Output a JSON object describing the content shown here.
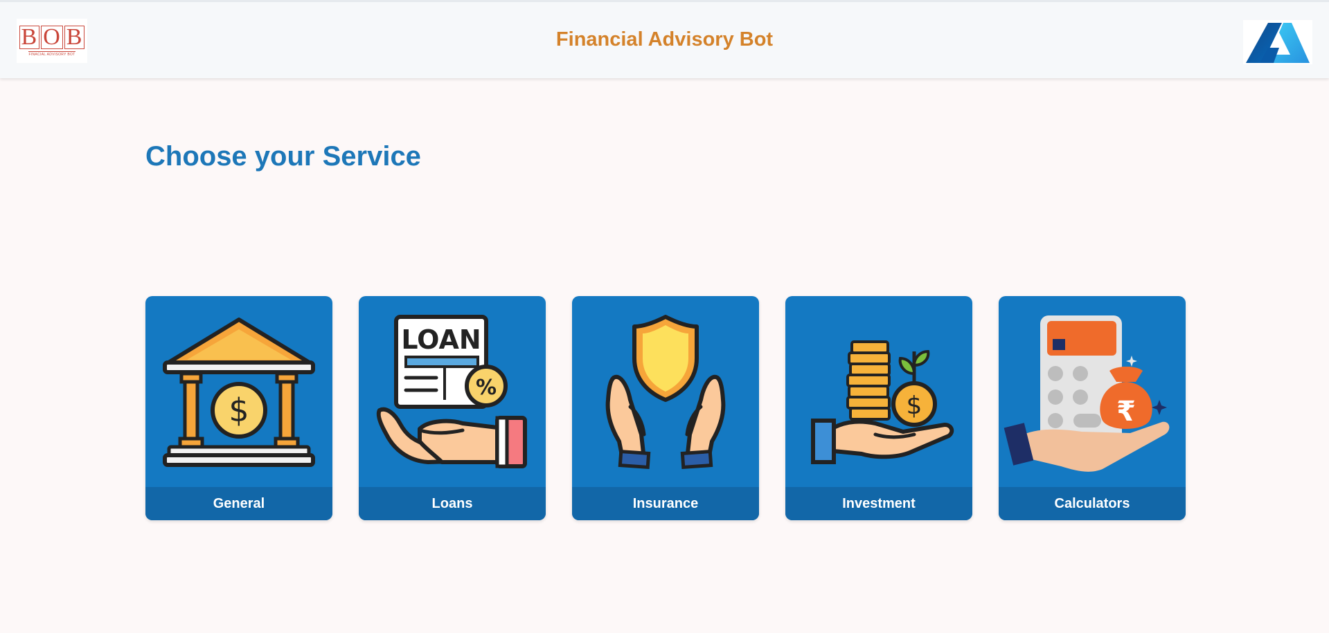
{
  "header": {
    "title": "Financial Advisory Bot",
    "left_logo": {
      "text": "BOB",
      "subtext": "FINACIAL ADVISORY BOT",
      "icon": "bob-logo-icon"
    },
    "right_logo": {
      "icon": "azure-logo-icon"
    }
  },
  "main": {
    "heading": "Choose your Service",
    "services": [
      {
        "label": "General",
        "icon": "bank-icon"
      },
      {
        "label": "Loans",
        "icon": "loan-icon"
      },
      {
        "label": "Insurance",
        "icon": "insurance-shield-icon"
      },
      {
        "label": "Investment",
        "icon": "investment-coins-icon"
      },
      {
        "label": "Calculators",
        "icon": "calculator-icon"
      }
    ]
  },
  "colors": {
    "header_title": "#d4822a",
    "heading": "#1d77b8",
    "card_bg": "#1479c2",
    "card_label_bg": "#1267a8",
    "page_bg": "#fdf8f8"
  }
}
